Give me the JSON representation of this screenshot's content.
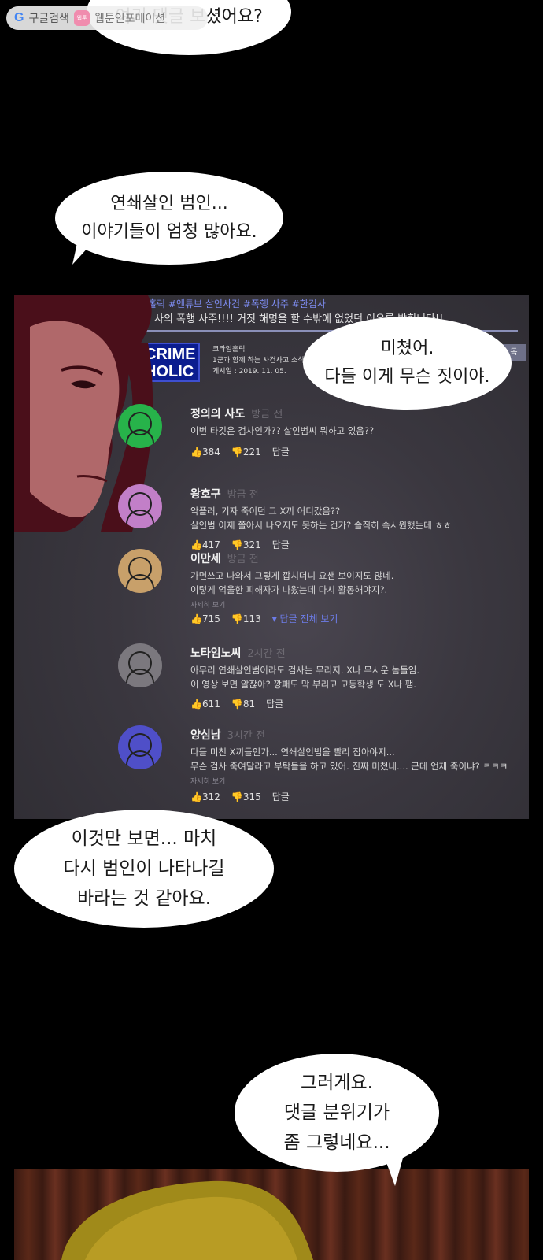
{
  "watermark": {
    "g_icon": "G",
    "label1": "구글검색",
    "badge": "웹툰",
    "label2": "웹툰인포메이션"
  },
  "bubbles": {
    "b1": "여기 댓글 보셨어요?",
    "b2_l1": "연쇄살인 범인...",
    "b2_l2": "이야기들이 엄청 많아요.",
    "b3_l1": "미쳤어.",
    "b3_l2": "다들 이게 무슨 짓이야.",
    "b4_l1": "이것만 보면... 마치",
    "b4_l2": "다시 범인이 나타나길",
    "b4_l3": "바라는 것 같아요.",
    "b5_l1": "그러게요.",
    "b5_l2": "댓글 분위기가",
    "b5_l3": "좀 그렇네요..."
  },
  "video": {
    "tags": "홀릭 #엔튜브 살인사건 #폭행 사주 #한검사",
    "title": "사의 폭행 사주!!!! 거짓 해명을 할 수밖에 없었던 이유를 밝힙니다!!",
    "logo_l1": "CRIME",
    "logo_l2": "HOLIC",
    "channel_name": "크라임홀릭",
    "channel_desc": "1군과 함께 하는 사건사고 소식",
    "posted": "게시일 : 2019. 11. 05.",
    "subscribe": "독"
  },
  "comments": [
    {
      "name": "정의의 사도",
      "time": "방금 전",
      "color": "#27b34a",
      "lines": [
        "이번 타깃은 검사인가?? 살인범씨 뭐하고 있음??"
      ],
      "more": "",
      "likes": "384",
      "dislikes": "221",
      "reply": "답글",
      "reply_all": ""
    },
    {
      "name": "왕호구",
      "time": "방금 전",
      "color": "#c27fc8",
      "lines": [
        "악플러, 기자 죽이던 그 X끼 어디갔음??",
        "살인범 이제 쫄아서 나오지도 못하는 건가? 솔직히 속시원했는데 ㅎㅎ"
      ],
      "more": "",
      "likes": "417",
      "dislikes": "321",
      "reply": "답글",
      "reply_all": ""
    },
    {
      "name": "이만세",
      "time": "방금 전",
      "color": "#c8a06a",
      "lines": [
        "가면쓰고 나와서 그렇게 깝치더니 요샌 보이지도 않네.",
        "이렇게 억울한 피해자가 나왔는데 다시 활동해야지?."
      ],
      "more": "자세히 보기",
      "likes": "715",
      "dislikes": "113",
      "reply": "",
      "reply_all": "▾ 답글 전체 보기"
    },
    {
      "name": "노타임노씨",
      "time": "2시간 전",
      "color": "#7b787e",
      "lines": [
        "아무리 연쇄살인범이라도 검사는 무리지. X나 무서운 놈들임.",
        "이 영상 보면 알잖아? 깡패도 막 부리고 고등학생 도 X나 팸."
      ],
      "more": "",
      "likes": "611",
      "dislikes": "81",
      "reply": "답글",
      "reply_all": ""
    },
    {
      "name": "양심남",
      "time": "3시간 전",
      "color": "#4f4fc8",
      "lines": [
        "다들 미친 X끼들인가... 연쇄살인범을 빨리 잡아야지...",
        "무슨 검사 죽여달라고 부탁들을 하고 있어. 진짜 미쳤네.... 근데 언제 죽이냐? ㅋㅋㅋ"
      ],
      "more": "자세히 보기",
      "likes": "312",
      "dislikes": "315",
      "reply": "답글",
      "reply_all": ""
    }
  ]
}
